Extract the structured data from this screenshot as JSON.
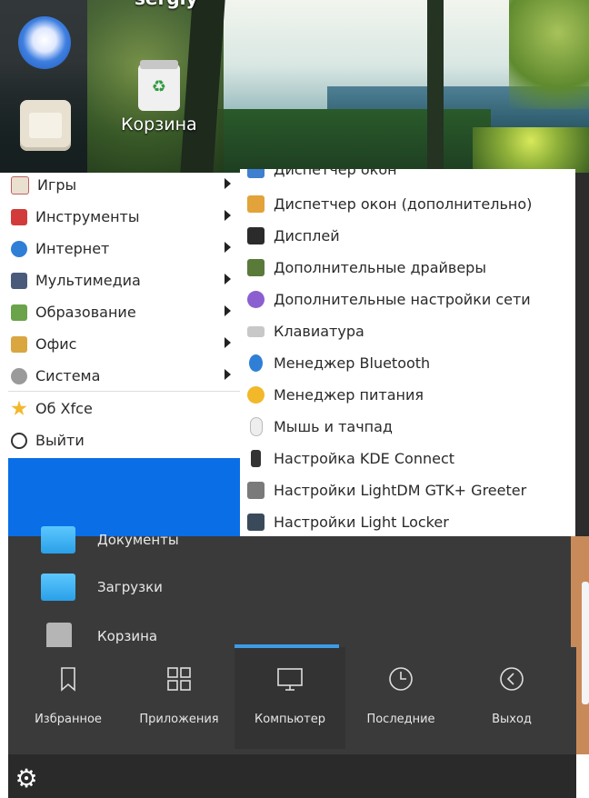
{
  "desktop": {
    "username": "sergiy",
    "trash_label": "Корзина"
  },
  "menu": {
    "left_items": [
      {
        "label": "Игры",
        "icon": "games-icon",
        "color": "#d9534f"
      },
      {
        "label": "Инструменты",
        "icon": "tools-icon",
        "color": "#d23b3b"
      },
      {
        "label": "Интернет",
        "icon": "globe-icon",
        "color": "#2f7fd6"
      },
      {
        "label": "Мультимедиа",
        "icon": "multimedia-icon",
        "color": "#4a5a7a"
      },
      {
        "label": "Образование",
        "icon": "education-icon",
        "color": "#6aa34a"
      },
      {
        "label": "Офис",
        "icon": "office-icon",
        "color": "#d9a640"
      },
      {
        "label": "Система",
        "icon": "system-icon",
        "color": "#9a9a9a"
      }
    ],
    "about_label": "Об Xfce",
    "logout_label": "Выйти",
    "right_items": [
      {
        "label": "Диспетчер окон",
        "icon": "window-manager-icon",
        "color": "#3f7fd0"
      },
      {
        "label": "Диспетчер окон (дополнительно)",
        "icon": "window-manager-advanced-icon",
        "color": "#e2a33a"
      },
      {
        "label": "Дисплей",
        "icon": "display-icon",
        "color": "#2b2b2b"
      },
      {
        "label": "Дополнительные драйверы",
        "icon": "drivers-icon",
        "color": "#5a7a3a"
      },
      {
        "label": "Дополнительные настройки сети",
        "icon": "network-settings-icon",
        "color": "#8b5fd0"
      },
      {
        "label": "Клавиатура",
        "icon": "keyboard-icon",
        "color": "#b8b8b8"
      },
      {
        "label": "Менеджер Bluetooth",
        "icon": "bluetooth-icon",
        "color": "#2f7fd6"
      },
      {
        "label": "Менеджер питания",
        "icon": "power-manager-icon",
        "color": "#f2b82a"
      },
      {
        "label": "Мышь и тачпад",
        "icon": "mouse-icon",
        "color": "#e6e6e6"
      },
      {
        "label": "Настройка KDE Connect",
        "icon": "kde-connect-icon",
        "color": "#333333"
      },
      {
        "label": "Настройки LightDM GTK+ Greeter",
        "icon": "lightdm-icon",
        "color": "#7a7a7a"
      },
      {
        "label": "Настройки Light Locker",
        "icon": "light-locker-icon",
        "color": "#3a4a5a"
      }
    ]
  },
  "places": [
    {
      "label": "Документы",
      "icon": "documents-folder-icon"
    },
    {
      "label": "Загрузки",
      "icon": "downloads-folder-icon"
    },
    {
      "label": "Корзина",
      "icon": "trash-icon"
    }
  ],
  "tabs": [
    {
      "label": "Избранное",
      "icon": "bookmark-icon"
    },
    {
      "label": "Приложения",
      "icon": "apps-grid-icon"
    },
    {
      "label": "Компьютер",
      "icon": "monitor-icon",
      "active": true
    },
    {
      "label": "Последние",
      "icon": "clock-icon"
    },
    {
      "label": "Выход",
      "icon": "back-circle-icon"
    }
  ],
  "colors": {
    "accent": "#0a6fe6",
    "indicator": "#3d9be8"
  }
}
